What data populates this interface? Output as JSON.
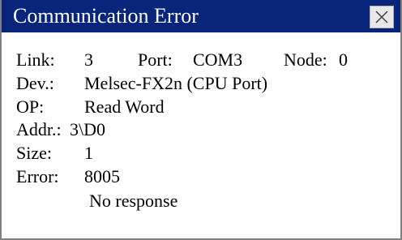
{
  "window": {
    "title": "Communication Error",
    "close_icon": "close-icon"
  },
  "info": {
    "link_label": "Link:",
    "link_value": "3",
    "port_label": "Port:",
    "port_value": "COM3",
    "node_label": "Node:",
    "node_value": "0",
    "dev_label": "Dev.:",
    "dev_value": "Melsec-FX2n (CPU Port)",
    "op_label": "OP:",
    "op_value": "Read Word",
    "addr_label": "Addr.:",
    "addr_value": "3\\D0",
    "size_label": "Size:",
    "size_value": "1",
    "error_label": "Error:",
    "error_value": "8005",
    "error_message": "No response"
  },
  "colors": {
    "titlebar": "#08247b",
    "title_text": "#ffffff",
    "body_background": "#ffffff"
  }
}
